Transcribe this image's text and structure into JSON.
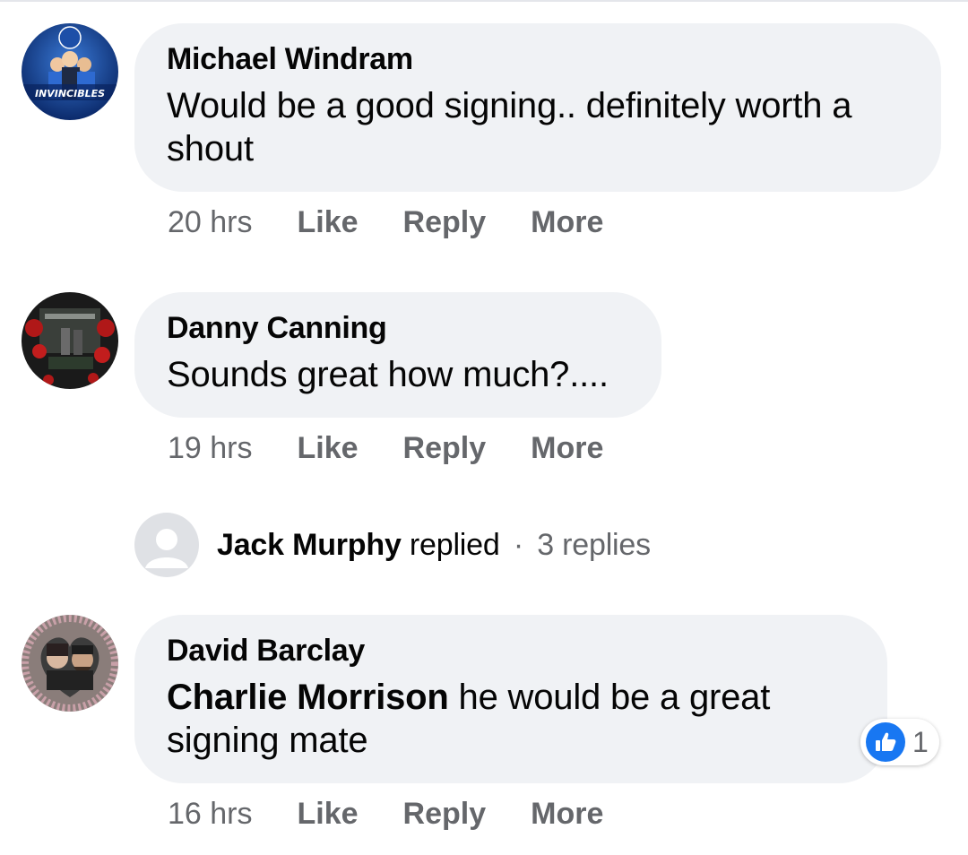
{
  "comments": [
    {
      "author": "Michael Windram",
      "text": "Would be a good signing.. definitely worth a shout",
      "time": "20 hrs",
      "avatar_caption": "INVINCIBLES"
    },
    {
      "author": "Danny Canning",
      "text": "Sounds great how much?....",
      "time": "19 hrs"
    },
    {
      "author": "David Barclay",
      "mention": "Charlie Morrison",
      "text": " he would be a great signing mate",
      "time": "16 hrs",
      "reaction_count": "1"
    }
  ],
  "actions": {
    "like": "Like",
    "reply": "Reply",
    "more": "More"
  },
  "replies_summary": {
    "name": "Jack Murphy",
    "verb": "replied",
    "separator": "·",
    "count": "3 replies"
  },
  "colors": {
    "bubble": "#f0f2f5",
    "meta_text": "#65676b",
    "like_blue": "#1877f2"
  }
}
